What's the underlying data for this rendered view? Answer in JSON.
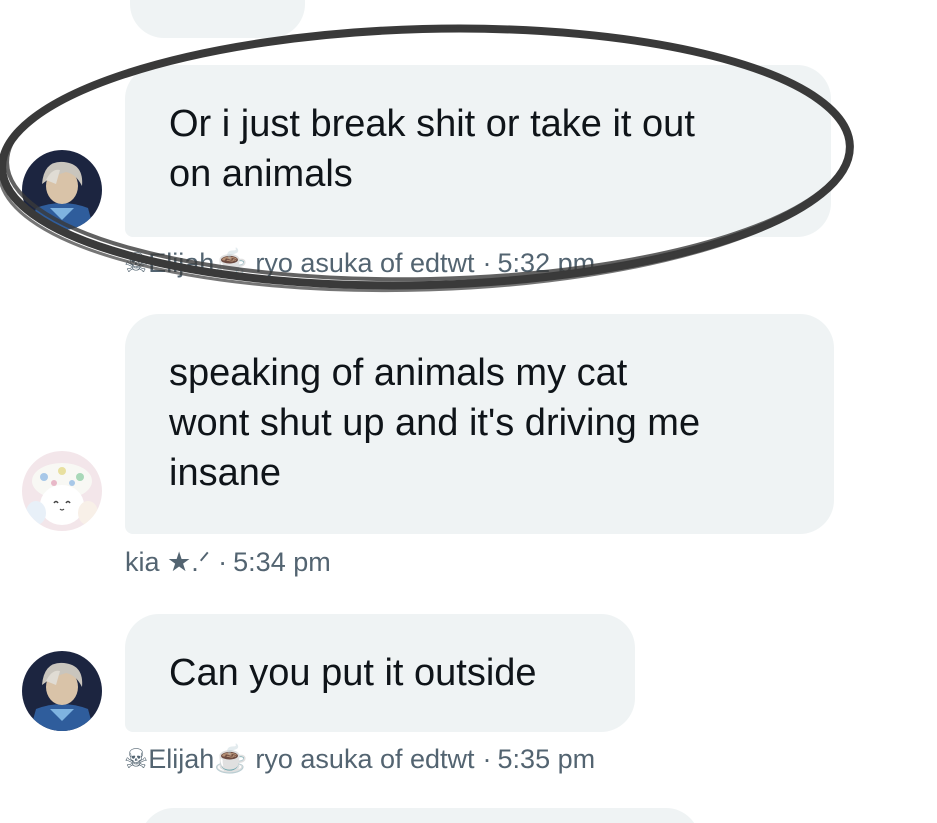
{
  "conversation": {
    "messages": [
      {
        "text": "Or i just break shit or take it out\non animals",
        "sender_prefix": "☠",
        "sender": "Elijah",
        "sender_suffix": "☕",
        "sender_handle": "ryo asuka of edtwt",
        "separator": "·",
        "time": "5:32 pm",
        "avatar": "anime-boy-avatar",
        "highlighted": true
      },
      {
        "text": "speaking of animals my cat\nwont shut up and it's driving me\ninsane",
        "sender": "kia ★.ᐟ",
        "separator": "·",
        "time": "5:34 pm",
        "avatar": "plush-cat-avatar"
      },
      {
        "text": "Can you put it outside",
        "sender_prefix": "☠",
        "sender": "Elijah",
        "sender_suffix": "☕",
        "sender_handle": "ryo asuka of edtwt",
        "separator": "·",
        "time": "5:35 pm",
        "avatar": "anime-boy-avatar"
      }
    ]
  },
  "colors": {
    "bubble": "#eff3f4",
    "text": "#0f1419",
    "meta_text": "#536471",
    "highlight_ring": "#3a3a3a"
  }
}
